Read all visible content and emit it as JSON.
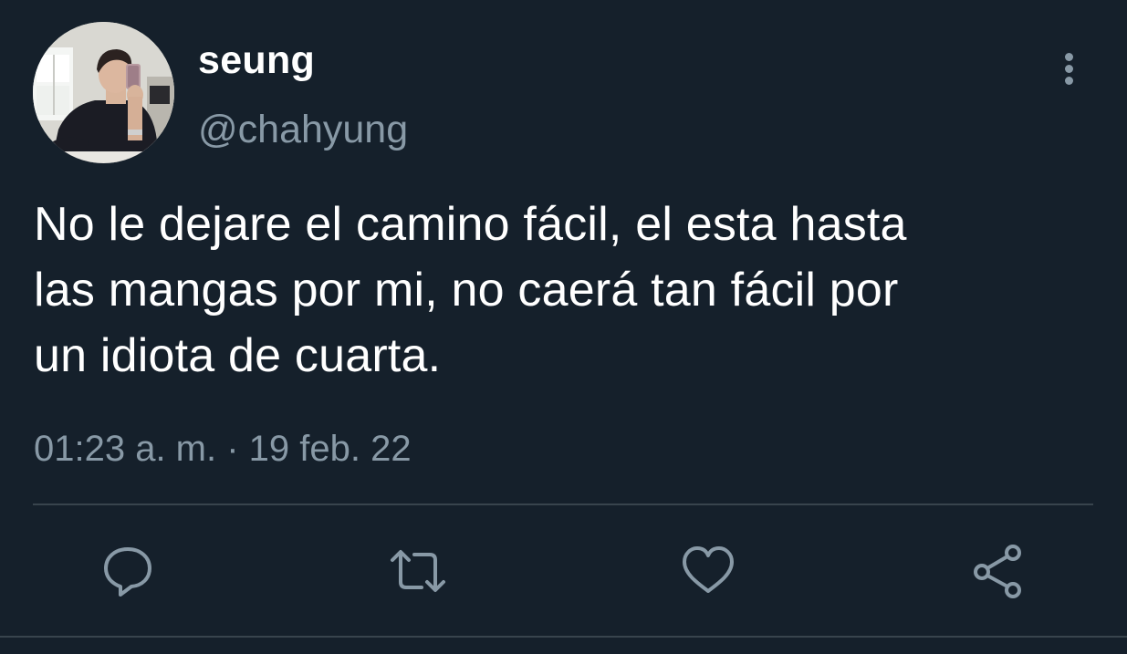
{
  "tweet": {
    "author": {
      "display_name": "seung",
      "handle": "@chahyung"
    },
    "text": "No le dejare el camino fácil, el esta hasta\nlas mangas por mi, no caerá tan fácil por\nun idiota de cuarta.",
    "timestamp": "01:23 a. m. · 19 feb. 22"
  },
  "actions": [
    {
      "icon": "reply-icon"
    },
    {
      "icon": "retweet-icon"
    },
    {
      "icon": "like-icon"
    },
    {
      "icon": "share-icon"
    }
  ],
  "menu": {
    "icon": "more-vertical-icon"
  },
  "colors": {
    "background": "#15202b",
    "primary_text": "#ffffff",
    "secondary_text": "#8899a6",
    "divider": "#38444d"
  }
}
